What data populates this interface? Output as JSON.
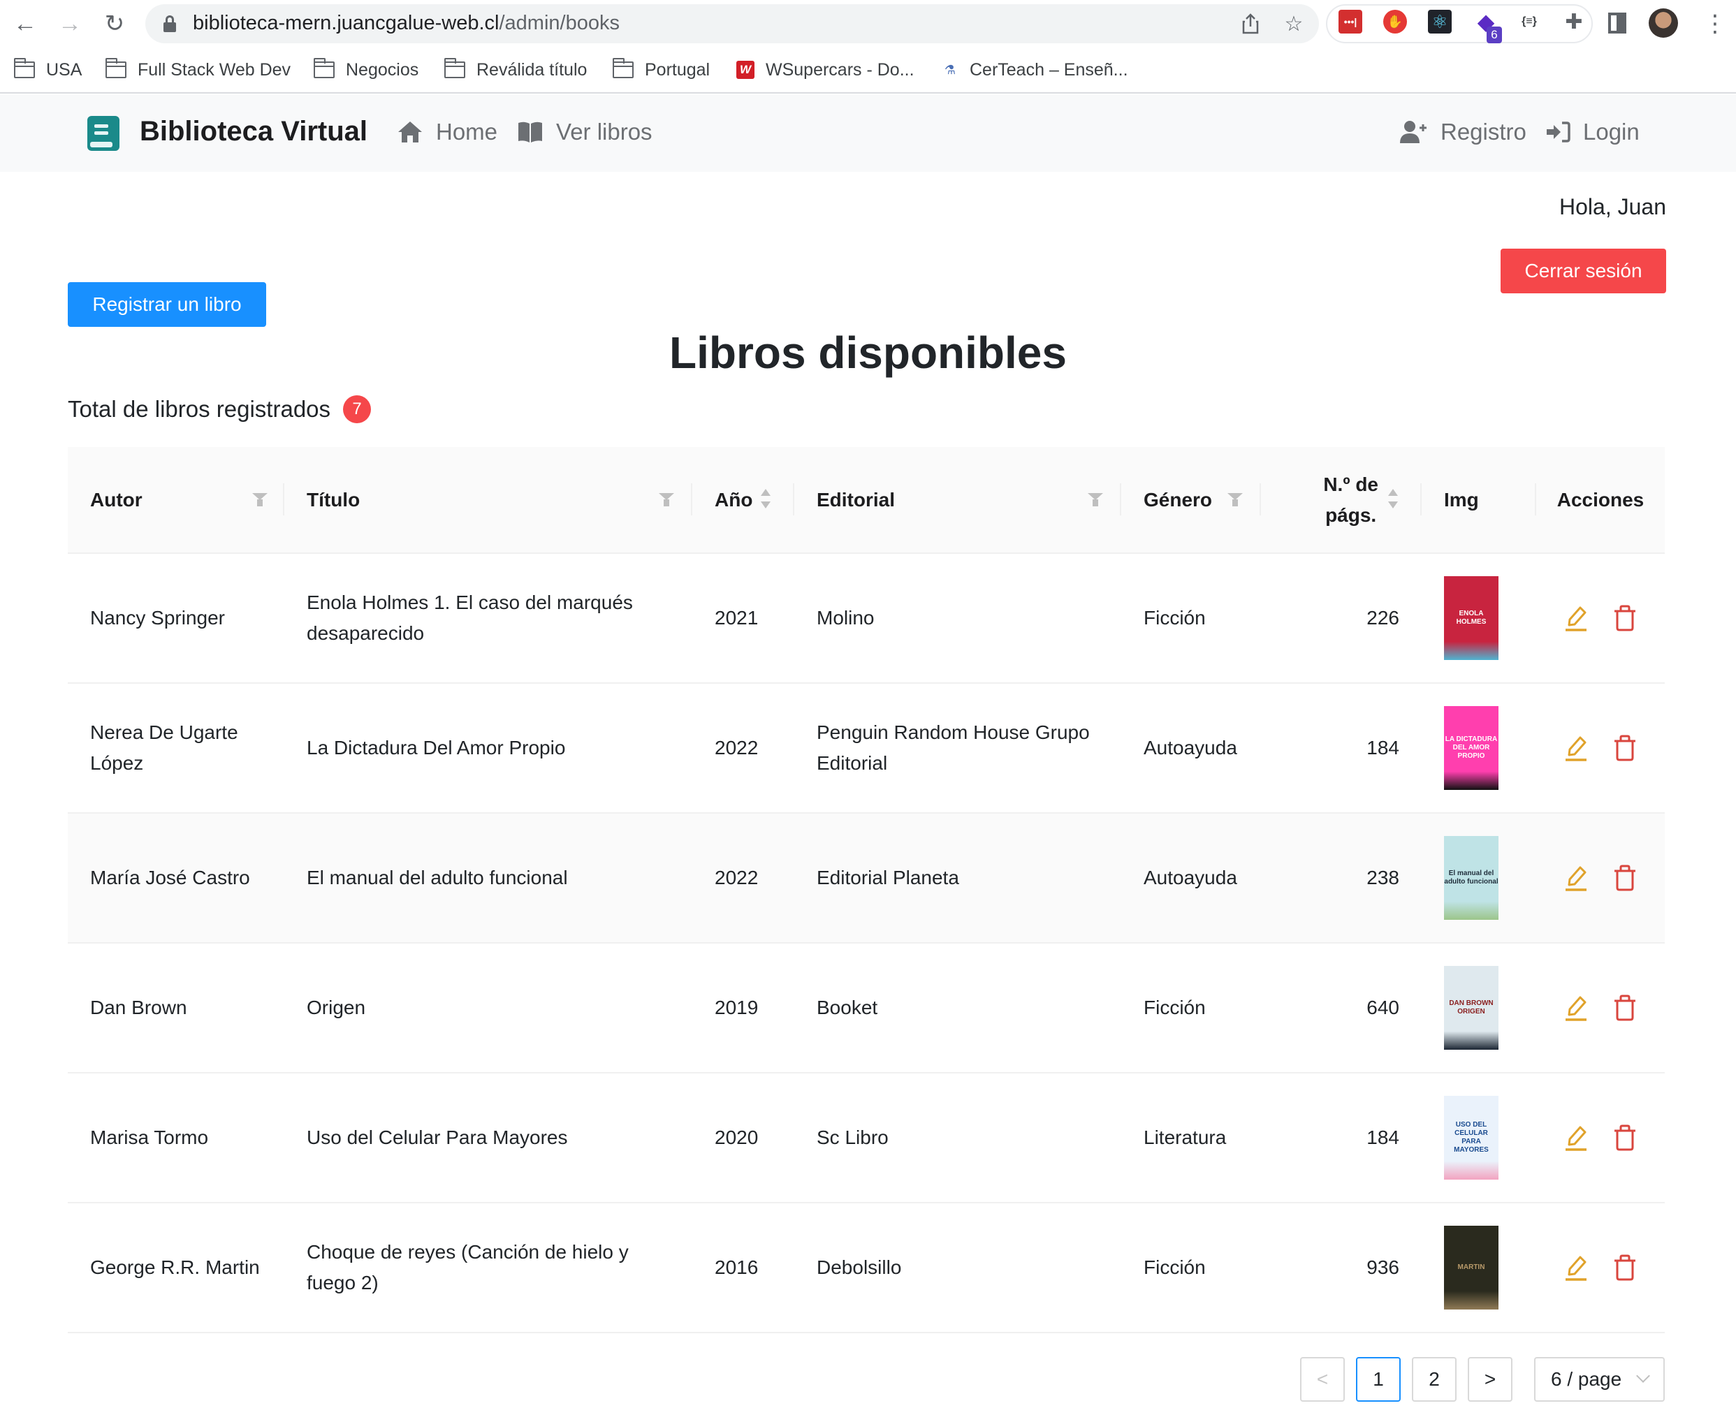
{
  "browser": {
    "url_host": "biblioteca-mern.juancgalue-web.cl",
    "url_path": "/admin/books",
    "extension_badge": "6",
    "bookmarks": [
      {
        "label": "USA",
        "icon": "folder-icon"
      },
      {
        "label": "Full Stack Web Dev",
        "icon": "folder-icon"
      },
      {
        "label": "Negocios",
        "icon": "folder-icon"
      },
      {
        "label": "Reválida título",
        "icon": "folder-icon"
      },
      {
        "label": "Portugal",
        "icon": "folder-icon"
      },
      {
        "label": "WSupercars - Do...",
        "icon": "wsupercars-favicon"
      },
      {
        "label": "CerTeach – Enseñ...",
        "icon": "certeach-favicon"
      }
    ]
  },
  "navbar": {
    "brand": "Biblioteca Virtual",
    "links": [
      {
        "label": "Home",
        "icon": "home-icon"
      },
      {
        "label": "Ver libros",
        "icon": "book-open-icon"
      }
    ],
    "right_links": [
      {
        "label": "Registro",
        "icon": "user-plus-icon"
      },
      {
        "label": "Login",
        "icon": "sign-in-icon"
      }
    ]
  },
  "user": {
    "greeting": "Hola, Juan",
    "logout_label": "Cerrar sesión"
  },
  "main": {
    "register_book_label": "Registrar un libro",
    "title": "Libros disponibles",
    "total_label": "Total de libros registrados",
    "total_count": "7"
  },
  "table": {
    "columns": [
      {
        "label": "Autor",
        "control": "filter"
      },
      {
        "label": "Título",
        "control": "filter"
      },
      {
        "label": "Año",
        "control": "sort"
      },
      {
        "label": "Editorial",
        "control": "filter"
      },
      {
        "label": "Género",
        "control": "filter"
      },
      {
        "label": "N.º de págs.",
        "label_line1": "N.º de",
        "label_line2": "págs.",
        "control": "sort"
      },
      {
        "label": "Img",
        "control": "none"
      },
      {
        "label": "Acciones",
        "control": "none"
      }
    ],
    "rows": [
      {
        "autor": "Nancy Springer",
        "titulo": "Enola Holmes 1. El caso del marqués desaparecido",
        "anio": "2021",
        "editorial": "Molino",
        "genero": "Ficción",
        "paginas": "226",
        "cover": {
          "text": "ENOLA HOLMES",
          "bg": "#c8243f",
          "fg": "#ffffff",
          "accent": "#4fb3d1"
        }
      },
      {
        "autor": "Nerea De Ugarte López",
        "titulo": "La Dictadura Del Amor Propio",
        "anio": "2022",
        "editorial": "Penguin Random House Grupo Editorial",
        "genero": "Autoayuda",
        "paginas": "184",
        "cover": {
          "text": "LA DICTADURA DEL AMOR PROPIO",
          "bg": "#ff3fae",
          "fg": "#ffffff",
          "accent": "#111111"
        }
      },
      {
        "autor": "María José Castro",
        "titulo": "El manual del adulto funcional",
        "anio": "2022",
        "editorial": "Editorial Planeta",
        "genero": "Autoayuda",
        "paginas": "238",
        "cover": {
          "text": "El manual del adulto funcional",
          "bg": "#bfe3e6",
          "fg": "#1f2d3a",
          "accent": "#9cc58a"
        }
      },
      {
        "autor": "Dan Brown",
        "titulo": "Origen",
        "anio": "2019",
        "editorial": "Booket",
        "genero": "Ficción",
        "paginas": "640",
        "cover": {
          "text": "DAN BROWN ORIGEN",
          "bg": "#dfe9ee",
          "fg": "#8a2020",
          "accent": "#1c2633"
        }
      },
      {
        "autor": "Marisa Tormo",
        "titulo": "Uso del Celular Para Mayores",
        "anio": "2020",
        "editorial": "Sc Libro",
        "genero": "Literatura",
        "paginas": "184",
        "cover": {
          "text": "USO DEL CELULAR PARA MAYORES",
          "bg": "#eaf2fb",
          "fg": "#1a4b8f",
          "accent": "#f2a3c0"
        }
      },
      {
        "autor": "George R.R. Martin",
        "titulo": "Choque de reyes (Canción de hielo y fuego 2)",
        "anio": "2016",
        "editorial": "Debolsillo",
        "genero": "Ficción",
        "paginas": "936",
        "cover": {
          "text": "MARTIN",
          "bg": "#2a2a1e",
          "fg": "#b89a6a",
          "accent": "#8f7a55"
        }
      }
    ],
    "hover_row_index": 2
  },
  "pagination": {
    "prev_label": "<",
    "pages": [
      "1",
      "2"
    ],
    "current_page": "1",
    "next_label": ">",
    "page_size_label": "6 / page"
  },
  "colors": {
    "primary": "#1890ff",
    "danger": "#f5474a",
    "brand": "#1a8a8a",
    "edit_icon": "#e0a22a",
    "delete_icon": "#d9463e"
  }
}
